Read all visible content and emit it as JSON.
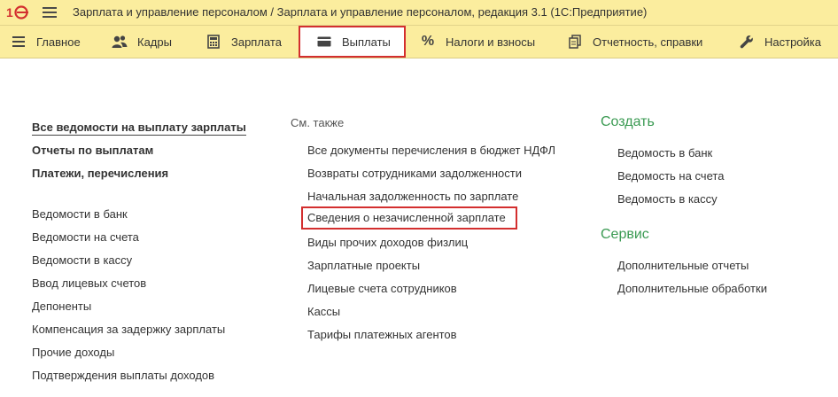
{
  "title_bar": {
    "app_title": "Зарплата и управление персоналом / Зарплата и управление персоналом, редакция 3.1  (1С:Предприятие)"
  },
  "sections": [
    {
      "label": "Главное",
      "icon": "burger-icon"
    },
    {
      "label": "Кадры",
      "icon": "users-icon"
    },
    {
      "label": "Зарплата",
      "icon": "calculator-icon"
    },
    {
      "label": "Выплаты",
      "icon": "card-icon",
      "active": true
    },
    {
      "label": "Налоги и взносы",
      "icon": "percent-icon"
    },
    {
      "label": "Отчетность, справки",
      "icon": "documents-icon"
    },
    {
      "label": "Настройка",
      "icon": "wrench-icon"
    }
  ],
  "left_column": {
    "top_links": [
      "Все ведомости на выплату зарплаты",
      "Отчеты по выплатам",
      "Платежи, перечисления"
    ],
    "links": [
      "Ведомости в банк",
      "Ведомости на счета",
      "Ведомости в кассу",
      "Ввод лицевых счетов",
      "Депоненты",
      "Компенсация за задержку зарплаты",
      "Прочие доходы",
      "Подтверждения выплаты доходов"
    ]
  },
  "see_also": {
    "heading": "См. также",
    "links": [
      "Все документы перечисления в бюджет НДФЛ",
      "Возвраты сотрудниками задолженности",
      "Начальная задолженность по зарплате",
      "Сведения о незачисленной зарплате",
      "Виды прочих доходов физлиц",
      "Зарплатные проекты",
      "Лицевые счета сотрудников",
      "Кассы",
      "Тарифы платежных агентов"
    ]
  },
  "create": {
    "heading": "Создать",
    "links": [
      "Ведомость в банк",
      "Ведомость на счета",
      "Ведомость в кассу"
    ]
  },
  "service": {
    "heading": "Сервис",
    "links": [
      "Дополнительные отчеты",
      "Дополнительные обработки"
    ]
  },
  "colors": {
    "panel": "#fbed9e",
    "highlight": "#d32f2f",
    "group_heading": "#3a9a52"
  }
}
